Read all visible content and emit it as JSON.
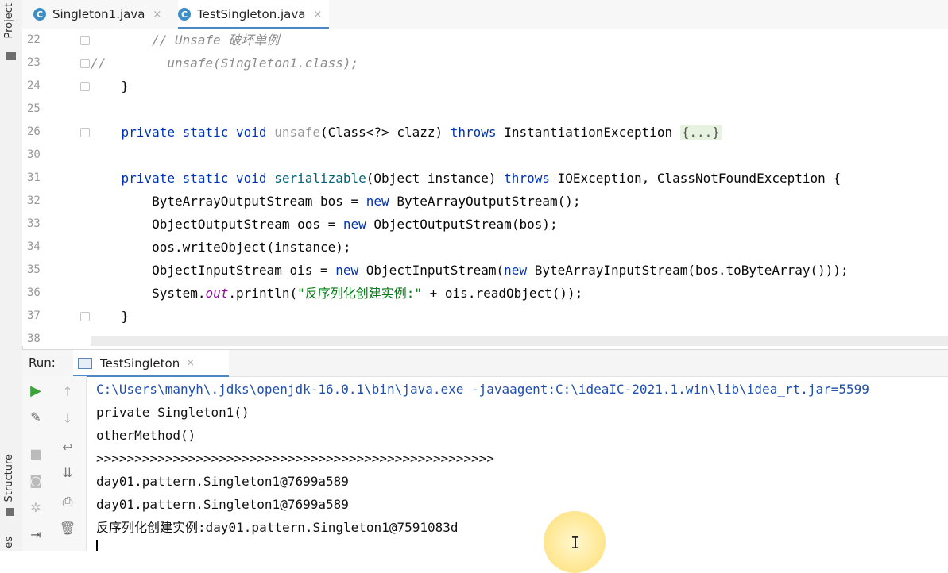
{
  "left_strip": {
    "project_label": "Project",
    "structure_label": "Structure",
    "bottom_label": "es"
  },
  "tabs": [
    {
      "label": "Singleton1.java",
      "icon": "C",
      "close": "×"
    },
    {
      "label": "TestSingleton.java",
      "icon": "C",
      "close": "×"
    }
  ],
  "code_lines": [
    {
      "num": "22",
      "parts": [
        [
          "cm",
          "        // Unsafe 破坏单例"
        ]
      ]
    },
    {
      "num": "23",
      "parts": [
        [
          "cm",
          "//        unsafe(Singleton1.class);"
        ]
      ]
    },
    {
      "num": "24",
      "parts": [
        [
          "",
          "    }"
        ]
      ]
    },
    {
      "num": "25",
      "parts": []
    },
    {
      "num": "26",
      "parts": [
        [
          "",
          "    "
        ],
        [
          "kw",
          "private static void "
        ],
        [
          "gray",
          "unsafe"
        ],
        [
          "",
          "(Class<?> clazz) "
        ],
        [
          "kw",
          "throws "
        ],
        [
          "",
          "InstantiationException "
        ],
        [
          "foldbox",
          "{...}"
        ]
      ]
    },
    {
      "num": "30",
      "parts": []
    },
    {
      "num": "31",
      "parts": [
        [
          "",
          "    "
        ],
        [
          "kw",
          "private static void "
        ],
        [
          "fn",
          "serializable"
        ],
        [
          "",
          "(Object instance) "
        ],
        [
          "kw",
          "throws "
        ],
        [
          "",
          "IOException, ClassNotFoundException {"
        ]
      ]
    },
    {
      "num": "32",
      "parts": [
        [
          "",
          "        ByteArrayOutputStream bos = "
        ],
        [
          "kw",
          "new "
        ],
        [
          "",
          "ByteArrayOutputStream();"
        ]
      ]
    },
    {
      "num": "33",
      "parts": [
        [
          "",
          "        ObjectOutputStream oos = "
        ],
        [
          "kw",
          "new "
        ],
        [
          "",
          "ObjectOutputStream(bos);"
        ]
      ]
    },
    {
      "num": "34",
      "parts": [
        [
          "",
          "        oos.writeObject(instance);"
        ]
      ]
    },
    {
      "num": "35",
      "parts": [
        [
          "",
          "        ObjectInputStream ois = "
        ],
        [
          "kw",
          "new "
        ],
        [
          "",
          "ObjectInputStream("
        ],
        [
          "kw",
          "new "
        ],
        [
          "",
          "ByteArrayInputStream(bos.toByteArray()));"
        ]
      ]
    },
    {
      "num": "36",
      "parts": [
        [
          "",
          "        System."
        ],
        [
          "it",
          "out"
        ],
        [
          "",
          ".println("
        ],
        [
          "st",
          "\"反序列化创建实例:\""
        ],
        [
          "",
          " + ois.readObject());"
        ]
      ]
    },
    {
      "num": "37",
      "parts": [
        [
          "",
          "    }"
        ]
      ]
    },
    {
      "num": "38",
      "parts": []
    }
  ],
  "run": {
    "label": "Run:",
    "tab_label": "TestSingleton",
    "tab_close": "×",
    "console_lines": [
      "C:\\Users\\manyh\\.jdks\\openjdk-16.0.1\\bin\\java.exe -javaagent:C:\\ideaIC-2021.1.win\\lib\\idea_rt.jar=5599",
      "private Singleton1()",
      "otherMethod()",
      ">>>>>>>>>>>>>>>>>>>>>>>>>>>>>>>>>>>>>>>>>>>>>>>>>>>>",
      "day01.pattern.Singleton1@7699a589",
      "day01.pattern.Singleton1@7699a589",
      "反序列化创建实例:day01.pattern.Singleton1@7591083d"
    ]
  },
  "colors": {
    "keyword": "#0033b3",
    "comment": "#8c8c8c",
    "string": "#067d17",
    "accent": "#4a88c7"
  }
}
